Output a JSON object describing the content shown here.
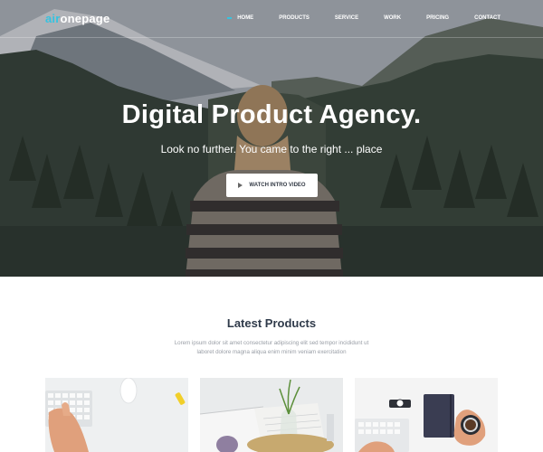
{
  "logo": {
    "prefix": "air",
    "suffix": "onepage"
  },
  "nav": {
    "items": [
      "HOME",
      "PRODUCTS",
      "SERVICE",
      "WORK",
      "PRICING",
      "CONTACT"
    ],
    "active": "HOME"
  },
  "hero": {
    "title": "Digital Product Agency.",
    "subtitle": "Look no further. You came to the right ... place",
    "cta_label": "WATCH INTRO VIDEO"
  },
  "products": {
    "title": "Latest Products",
    "description_line1": "Lorem ipsum dolor sit amet consectetur adipiscing elit sed tempor incididunt ut",
    "description_line2": "laboret dolore magna aliqua enim minim veniam exercitation"
  },
  "colors": {
    "accent": "#35c3e0",
    "heading": "#2f3a4a",
    "muted": "#999ea6"
  },
  "icons": {
    "cta": "play-icon"
  }
}
